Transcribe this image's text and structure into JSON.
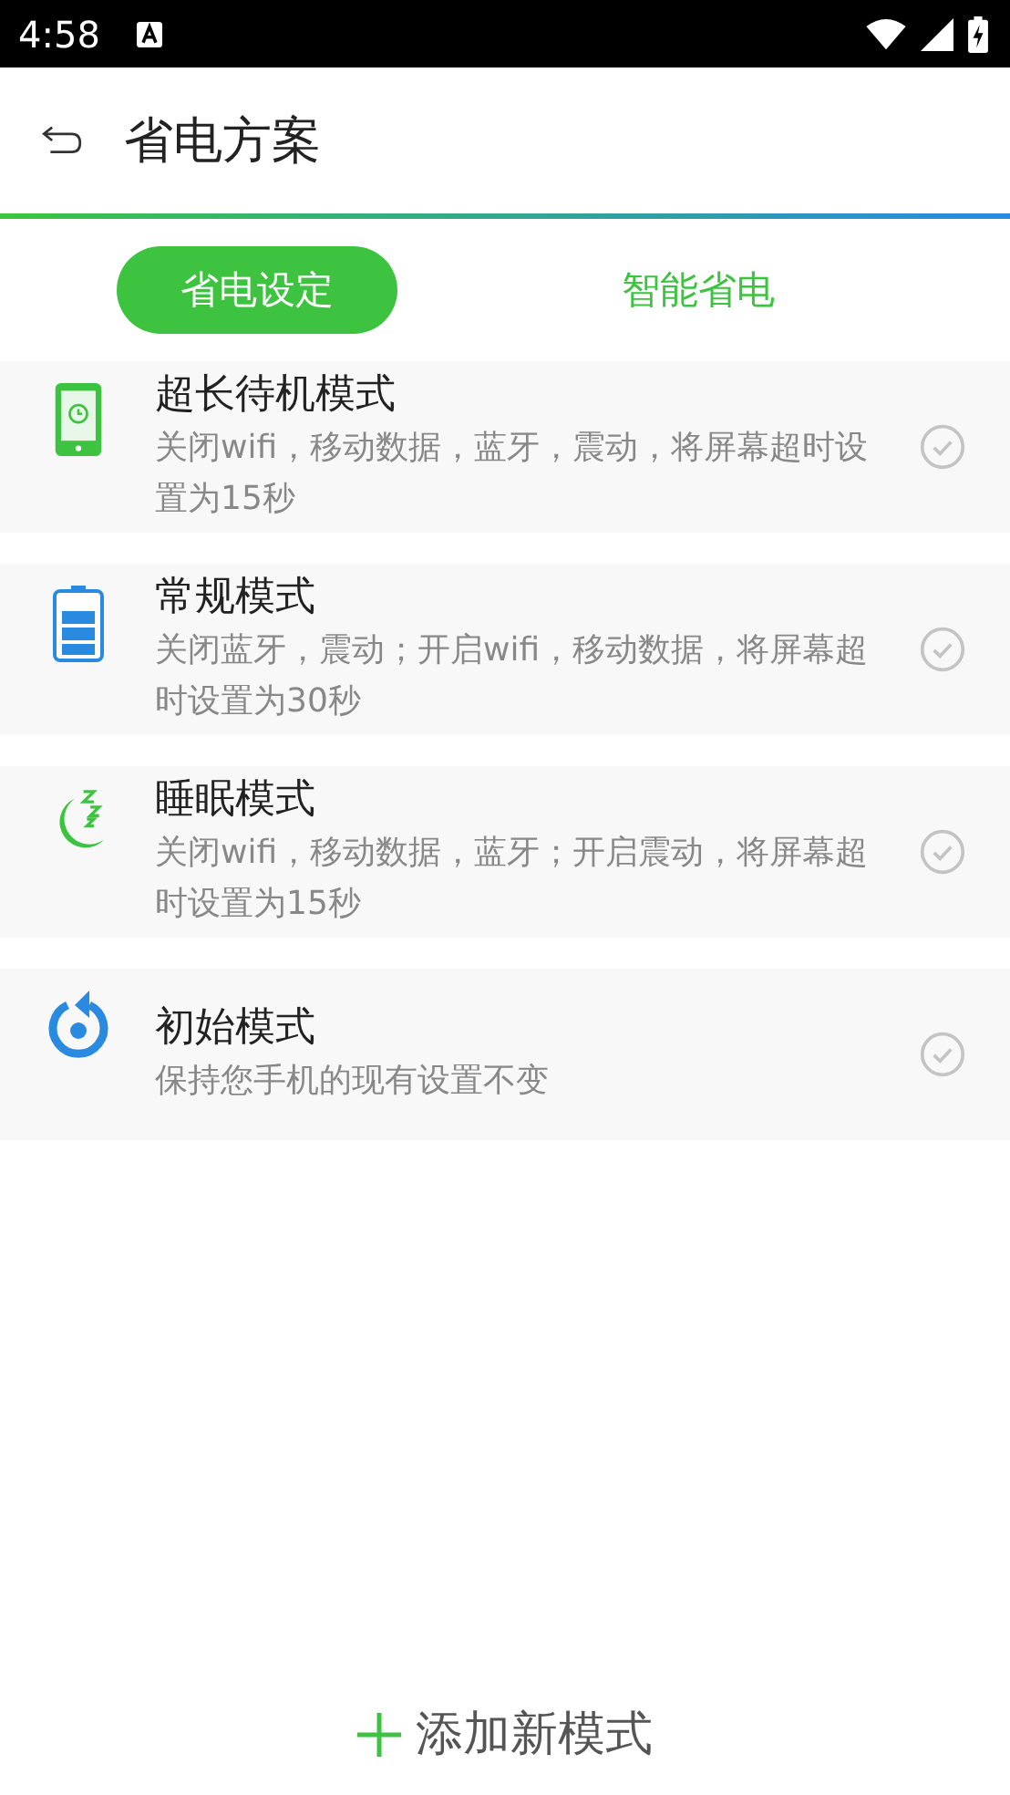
{
  "status_bar": {
    "time": "4:58"
  },
  "app_bar": {
    "title": "省电方案"
  },
  "tabs": [
    {
      "label": "省电设定",
      "selected": true
    },
    {
      "label": "智能省电",
      "selected": false
    }
  ],
  "modes": [
    {
      "kind": "phone",
      "title": "超长待机模式",
      "description": "关闭wifi，移动数据，蓝牙，震动，将屏幕超时设置为15秒",
      "selected": false
    },
    {
      "kind": "battery",
      "title": "常规模式",
      "description": "关闭蓝牙，震动；开启wifi，移动数据，将屏幕超时设置为30秒",
      "selected": false
    },
    {
      "kind": "sleep",
      "title": "睡眠模式",
      "description": "关闭wifi，移动数据，蓝牙；开启震动，将屏幕超时设置为15秒",
      "selected": false
    },
    {
      "kind": "reset",
      "title": "初始模式",
      "description": "保持您手机的现有设置不变",
      "selected": false
    }
  ],
  "add_button": {
    "label": "添加新模式"
  }
}
